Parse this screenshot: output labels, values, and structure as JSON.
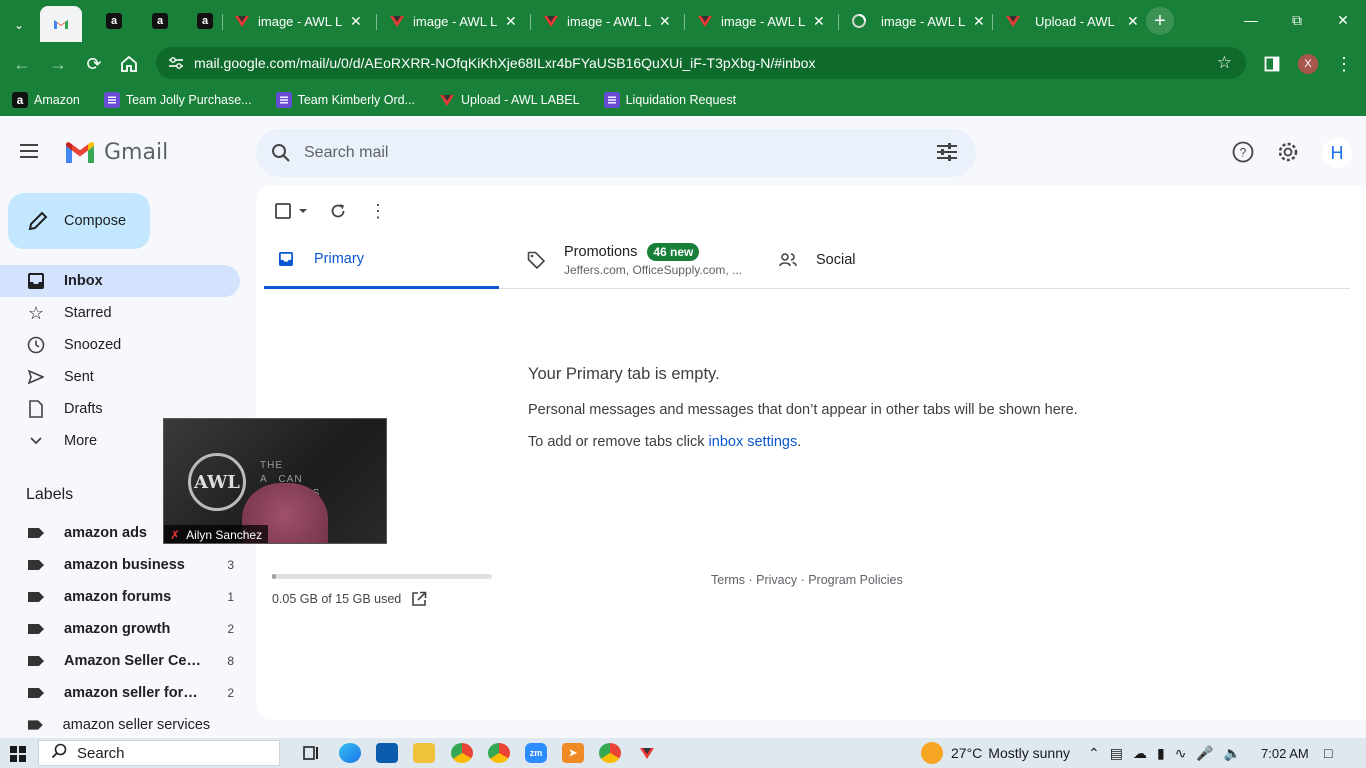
{
  "browser": {
    "tabs": [
      {
        "label": "",
        "icon": "gmail"
      },
      {
        "label": "",
        "icon": "amazon"
      },
      {
        "label": "",
        "icon": "amazon"
      },
      {
        "label": "",
        "icon": "amazon"
      },
      {
        "label": "image - AWL LA",
        "icon": "awl"
      },
      {
        "label": "image - AWL LA",
        "icon": "awl"
      },
      {
        "label": "image - AWL LA",
        "icon": "awl"
      },
      {
        "label": "image - AWL LA",
        "icon": "awl"
      },
      {
        "label": "image - AWL LA",
        "icon": "loading"
      },
      {
        "label": "Upload - AWL L",
        "icon": "awl"
      }
    ],
    "url": "mail.google.com/mail/u/0/d/AEoRXRR-NOfqKiKhXje68ILxr4bFYaUSB16QuXUi_iF-T3pXbg-N/#inbox",
    "profile_initial": "X",
    "bookmarks": [
      {
        "label": "Amazon",
        "icon": "amazon"
      },
      {
        "label": "Team Jolly Purchase...",
        "icon": "forms"
      },
      {
        "label": "Team Kimberly Ord...",
        "icon": "forms"
      },
      {
        "label": "Upload - AWL LABEL",
        "icon": "awl"
      },
      {
        "label": "Liquidation Request",
        "icon": "forms"
      }
    ]
  },
  "gmail": {
    "brand": "Gmail",
    "search_placeholder": "Search mail",
    "avatar_initial": "H",
    "compose_label": "Compose",
    "nav": [
      {
        "label": "Inbox",
        "icon": "inbox-icon",
        "active": true
      },
      {
        "label": "Starred",
        "icon": "star-icon"
      },
      {
        "label": "Snoozed",
        "icon": "clock-icon"
      },
      {
        "label": "Sent",
        "icon": "send-icon"
      },
      {
        "label": "Drafts",
        "icon": "draft-icon"
      },
      {
        "label": "More",
        "icon": "chevron-down-icon"
      }
    ],
    "labels_title": "Labels",
    "labels": [
      {
        "name": "amazon ads",
        "count": ""
      },
      {
        "name": "amazon business",
        "count": "3"
      },
      {
        "name": "amazon forums",
        "count": "1"
      },
      {
        "name": "amazon growth",
        "count": "2"
      },
      {
        "name": "Amazon Seller Cen...",
        "count": "8"
      },
      {
        "name": "amazon seller foru...",
        "count": "2"
      },
      {
        "name": "amazon seller services",
        "count": ""
      }
    ],
    "tabs": {
      "primary": "Primary",
      "promotions": "Promotions",
      "promotions_badge": "46 new",
      "promotions_senders": "Jeffers.com, OfficeSupply.com, ...",
      "social": "Social"
    },
    "empty": {
      "heading": "Your Primary tab is empty.",
      "message": "Personal messages and messages that don’t appear in other tabs will be shown here.",
      "settings_prefix": "To add or remove tabs click ",
      "settings_link": "inbox settings",
      "settings_suffix": "."
    },
    "storage": {
      "text": "0.05 GB of 15 GB used",
      "fraction": 0.0033
    },
    "footer": "Terms · Privacy · Program Policies"
  },
  "video_overlay": {
    "participant": "Ailyn Sanchez",
    "logo_text": "AWL",
    "banner_text": "THE\nA   CAN\n        LERS"
  },
  "taskbar": {
    "search_label": "Search",
    "weather_temp": "27°C",
    "weather_text": "Mostly sunny",
    "time": "7:02 AM"
  },
  "colors": {
    "chrome_green": "#188038",
    "compose_bg": "#c2e7ff",
    "active_nav": "#d3e3fd",
    "primary_blue": "#0b57d0"
  }
}
